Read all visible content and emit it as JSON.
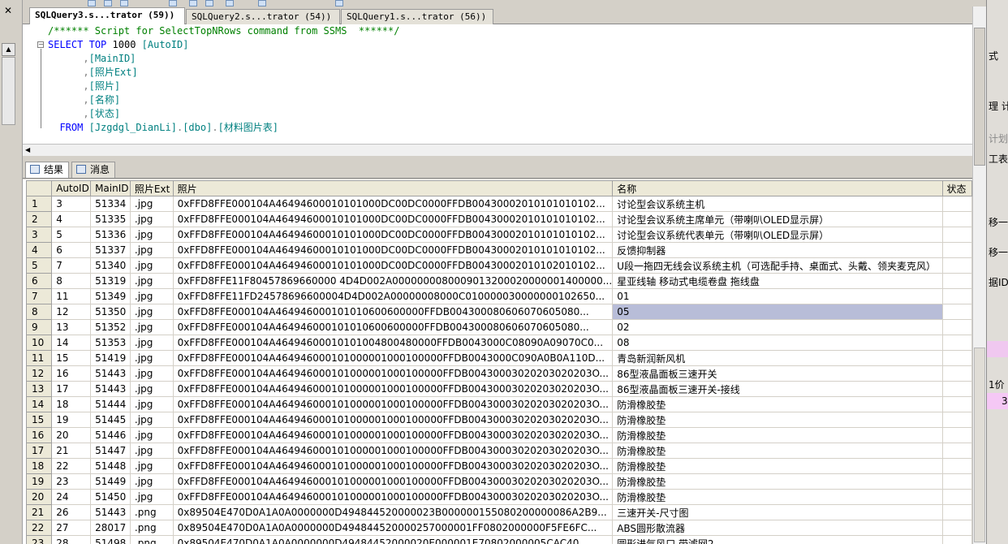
{
  "document_tabs": [
    {
      "label": "SQLQuery3.s...trator (59))",
      "active": true
    },
    {
      "label": "SQLQuery2.s...trator (54))",
      "active": false
    },
    {
      "label": "SQLQuery1.s...trator (56))",
      "active": false
    }
  ],
  "editor": {
    "comment": "/****** Script for SelectTopNRows command from SSMS  ******/",
    "select_kw": "SELECT",
    "top_kw": "TOP",
    "top_n": "1000",
    "cols": [
      "[AutoID]",
      "[MainID]",
      "[照片Ext]",
      "[照片]",
      "[名称]",
      "[状态]"
    ],
    "from_kw": "FROM",
    "db": "[Jzgdgl_DianLi]",
    "schema": "[dbo]",
    "table": "[材料图片表]"
  },
  "results_tabs": [
    {
      "label": "结果",
      "active": true
    },
    {
      "label": "消息",
      "active": false
    }
  ],
  "grid": {
    "columns": [
      "AutoID",
      "MainID",
      "照片Ext",
      "照片",
      "名称",
      "状态"
    ],
    "selected_row": 8,
    "rows": [
      {
        "rn": "1",
        "autoid": "3",
        "mainid": "51334",
        "ext": ".jpg",
        "photo": "0xFFD8FFE000104A46494600010101000DC00DC0000FFDB00430002010101010102...",
        "name": "讨论型会议系统主机",
        "status": ""
      },
      {
        "rn": "2",
        "autoid": "4",
        "mainid": "51335",
        "ext": ".jpg",
        "photo": "0xFFD8FFE000104A46494600010101000DC00DC0000FFDB00430002010101010102...",
        "name": "讨论型会议系统主席单元（带喇叭OLED显示屏）",
        "status": ""
      },
      {
        "rn": "3",
        "autoid": "5",
        "mainid": "51336",
        "ext": ".jpg",
        "photo": "0xFFD8FFE000104A46494600010101000DC00DC0000FFDB00430002010101010102...",
        "name": "讨论型会议系统代表单元（带喇叭OLED显示屏）",
        "status": ""
      },
      {
        "rn": "4",
        "autoid": "6",
        "mainid": "51337",
        "ext": ".jpg",
        "photo": "0xFFD8FFE000104A46494600010101000DC00DC0000FFDB00430002010101010102...",
        "name": "反馈抑制器",
        "status": ""
      },
      {
        "rn": "5",
        "autoid": "7",
        "mainid": "51340",
        "ext": ".jpg",
        "photo": "0xFFD8FFE000104A46494600010101000DC00DC0000FFDB00430002010102010102...",
        "name": "U段一拖四无线会议系统主机（可选配手持、桌面式、头戴、领夹麦克风）",
        "status": ""
      },
      {
        "rn": "6",
        "autoid": "8",
        "mainid": "51319",
        "ext": ".jpg",
        "photo": "0xFFD8FFE11F80457869660000 4D4D002A0000000080009013200020000001400000...",
        "name": "星亚线轴 移动式电缆卷盘 拖线盘",
        "status": ""
      },
      {
        "rn": "7",
        "autoid": "11",
        "mainid": "51349",
        "ext": ".jpg",
        "photo": "0xFFD8FFE11FD24578696600004D4D002A00000008000C010000030000000102650...",
        "name": "01",
        "status": ""
      },
      {
        "rn": "8",
        "autoid": "12",
        "mainid": "51350",
        "ext": ".jpg",
        "photo": "0xFFD8FFE000104A464946000101010600600000FFDB004300080606070605080...",
        "name": "05",
        "status": ""
      },
      {
        "rn": "9",
        "autoid": "13",
        "mainid": "51352",
        "ext": ".jpg",
        "photo": "0xFFD8FFE000104A464946000101010600600000FFDB004300080606070605080...",
        "name": "02",
        "status": ""
      },
      {
        "rn": "10",
        "autoid": "14",
        "mainid": "51353",
        "ext": ".jpg",
        "photo": "0xFFD8FFE000104A46494600010101004800480000FFDB0043000C08090A09070C0...",
        "name": "08",
        "status": ""
      },
      {
        "rn": "11",
        "autoid": "15",
        "mainid": "51419",
        "ext": ".jpg",
        "photo": "0xFFD8FFE000104A464946000101000001000100000FFDB0043000C090A0B0A110D...",
        "name": "青岛新润新风机",
        "status": ""
      },
      {
        "rn": "12",
        "autoid": "16",
        "mainid": "51443",
        "ext": ".jpg",
        "photo": "0xFFD8FFE000104A464946000101000001000100000FFDB00430003020203020203O...",
        "name": "86型液晶面板三速开关",
        "status": ""
      },
      {
        "rn": "13",
        "autoid": "17",
        "mainid": "51443",
        "ext": ".jpg",
        "photo": "0xFFD8FFE000104A464946000101000001000100000FFDB00430003020203020203O...",
        "name": "86型液晶面板三速开关-接线",
        "status": ""
      },
      {
        "rn": "14",
        "autoid": "18",
        "mainid": "51444",
        "ext": ".jpg",
        "photo": "0xFFD8FFE000104A464946000101000001000100000FFDB00430003020203020203O...",
        "name": "防滑橡胶垫",
        "status": ""
      },
      {
        "rn": "15",
        "autoid": "19",
        "mainid": "51445",
        "ext": ".jpg",
        "photo": "0xFFD8FFE000104A464946000101000001000100000FFDB00430003020203020203O...",
        "name": "防滑橡胶垫",
        "status": ""
      },
      {
        "rn": "16",
        "autoid": "20",
        "mainid": "51446",
        "ext": ".jpg",
        "photo": "0xFFD8FFE000104A464946000101000001000100000FFDB00430003020203020203O...",
        "name": "防滑橡胶垫",
        "status": ""
      },
      {
        "rn": "17",
        "autoid": "21",
        "mainid": "51447",
        "ext": ".jpg",
        "photo": "0xFFD8FFE000104A464946000101000001000100000FFDB00430003020203020203O...",
        "name": "防滑橡胶垫",
        "status": ""
      },
      {
        "rn": "18",
        "autoid": "22",
        "mainid": "51448",
        "ext": ".jpg",
        "photo": "0xFFD8FFE000104A464946000101000001000100000FFDB00430003020203020203O...",
        "name": "防滑橡胶垫",
        "status": ""
      },
      {
        "rn": "19",
        "autoid": "23",
        "mainid": "51449",
        "ext": ".jpg",
        "photo": "0xFFD8FFE000104A464946000101000001000100000FFDB00430003020203020203O...",
        "name": "防滑橡胶垫",
        "status": ""
      },
      {
        "rn": "20",
        "autoid": "24",
        "mainid": "51450",
        "ext": ".jpg",
        "photo": "0xFFD8FFE000104A464946000101000001000100000FFDB00430003020203020203O...",
        "name": "防滑橡胶垫",
        "status": ""
      },
      {
        "rn": "21",
        "autoid": "26",
        "mainid": "51443",
        "ext": ".png",
        "photo": "0x89504E470D0A1A0A0000000D494844520000023B000000155080200000086A2B9...",
        "name": "三速开关-尺寸图",
        "status": ""
      },
      {
        "rn": "22",
        "autoid": "27",
        "mainid": "28017",
        "ext": ".png",
        "photo": "0x89504E470D0A1A0A0000000D494844520000257000001FF0802000000F5FE6FC...",
        "name": "ABS圆形散流器",
        "status": ""
      },
      {
        "rn": "23",
        "autoid": "28",
        "mainid": "51498",
        "ext": ".png",
        "photo": "0x89504E470D0A1A0A0000000D49484452000020E000001E70802000005CAC40...",
        "name": "圆形进气风口 带滤网2",
        "status": ""
      }
    ]
  },
  "right_panel": {
    "lines": [
      {
        "text": "式",
        "bg": ""
      },
      {
        "text": "理 计",
        "bg": ""
      },
      {
        "text": "计划",
        "bg": ""
      },
      {
        "text": "工表",
        "bg": ""
      },
      {
        "text": "移一",
        "bg": ""
      },
      {
        "text": "移一",
        "bg": ""
      },
      {
        "text": "据ID",
        "bg": ""
      },
      {
        "text": "",
        "bg": "#f0c8f0"
      },
      {
        "text": "1价",
        "bg": ""
      },
      {
        "text": "3",
        "bg": "#f5c8f5"
      }
    ]
  },
  "colors": {
    "keyword": "#0000ff",
    "comment": "#008000",
    "identifier": "#008080",
    "selected_cell": "#b8bdd8"
  }
}
